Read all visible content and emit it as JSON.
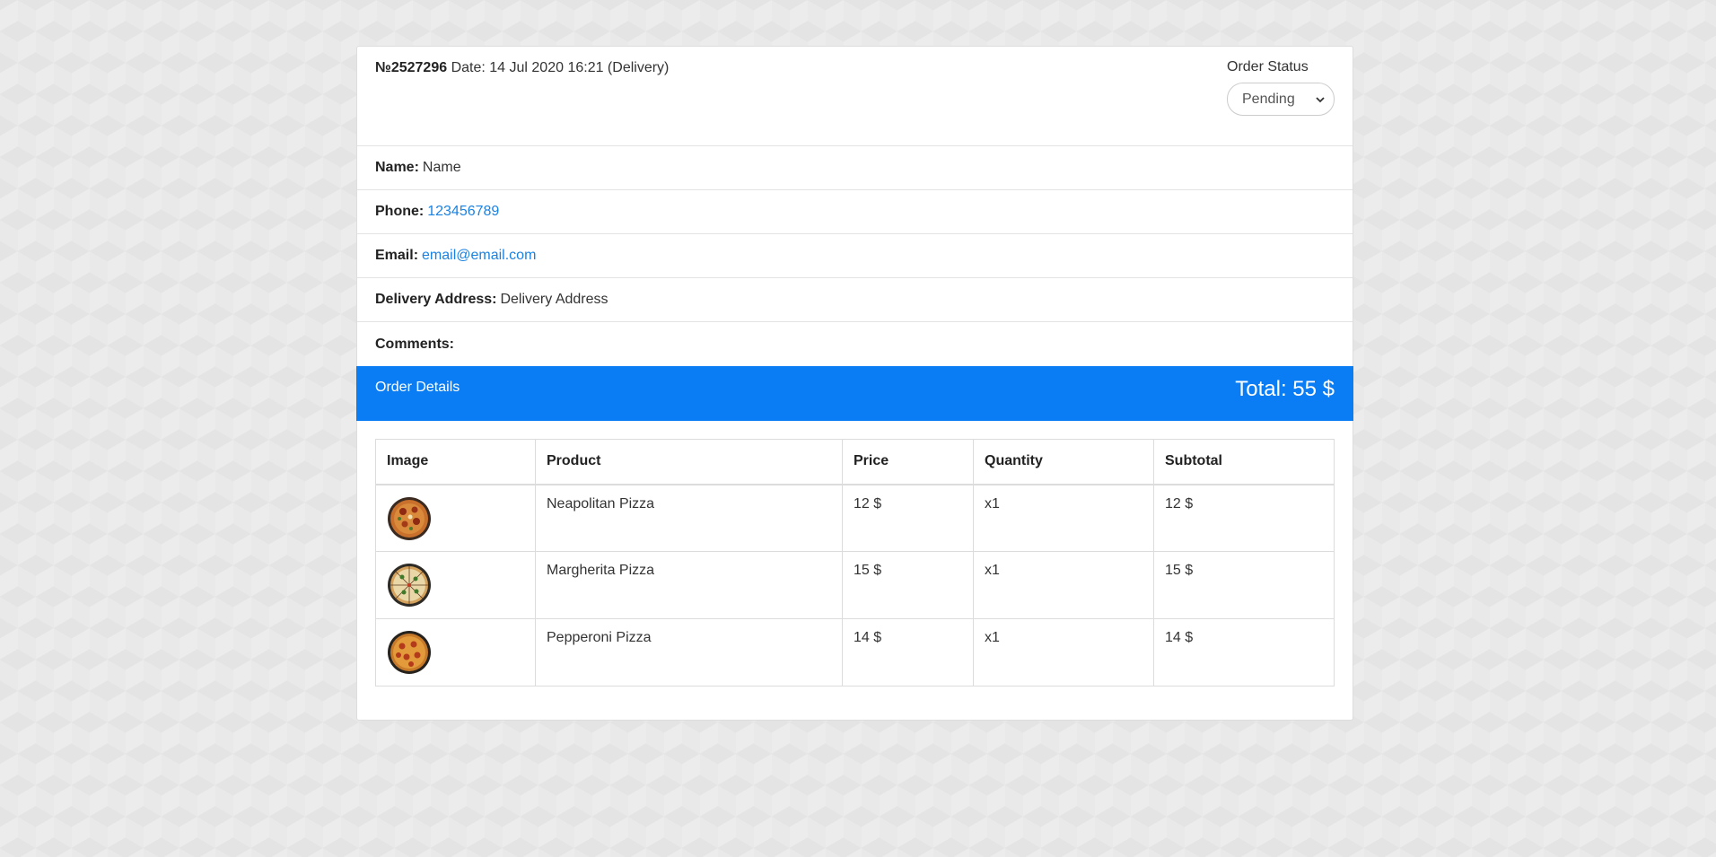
{
  "order": {
    "number": "№2527296",
    "date_text": "Date: 14 Jul 2020 16:21 (Delivery)",
    "status_label": "Order Status",
    "status_value": "Pending"
  },
  "customer": {
    "name_label": "Name:",
    "name_value": "Name",
    "phone_label": "Phone:",
    "phone_value": "123456789",
    "email_label": "Email:",
    "email_value": "email@email.com",
    "address_label": "Delivery Address:",
    "address_value": "Delivery Address",
    "comments_label": "Comments:",
    "comments_value": ""
  },
  "details": {
    "title": "Order Details",
    "total": "Total: 55 $"
  },
  "table": {
    "headers": [
      "Image",
      "Product",
      "Price",
      "Quantity",
      "Subtotal"
    ],
    "rows": [
      {
        "product": "Neapolitan Pizza",
        "price": "12 $",
        "quantity": "x1",
        "subtotal": "12 $"
      },
      {
        "product": "Margherita Pizza",
        "price": "15 $",
        "quantity": "x1",
        "subtotal": "15 $"
      },
      {
        "product": "Pepperoni Pizza",
        "price": "14 $",
        "quantity": "x1",
        "subtotal": "14 $"
      }
    ]
  },
  "colors": {
    "accent": "#0a7df5",
    "link": "#1a82e2"
  }
}
